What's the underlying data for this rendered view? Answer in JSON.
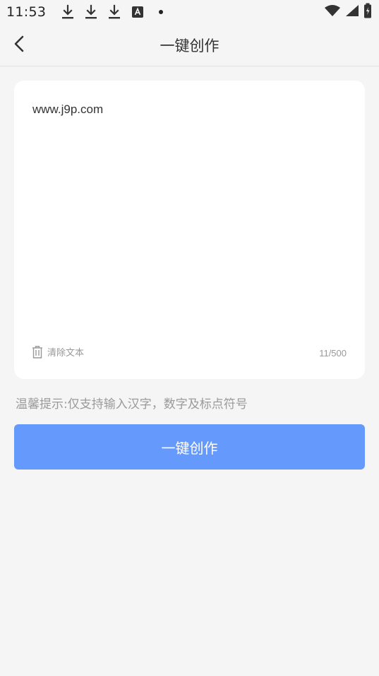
{
  "status_bar": {
    "time": "11:53",
    "icons": [
      "download-icon",
      "download-icon",
      "download-icon",
      "text-a-icon",
      "dot-icon"
    ],
    "right_icons": [
      "wifi-icon",
      "signal-icon",
      "battery-charging-icon"
    ]
  },
  "header": {
    "title": "一键创作",
    "back_icon": "chevron-left-icon"
  },
  "editor": {
    "value": "www.j9p.com",
    "clear_label": "清除文本",
    "clear_icon": "trash-icon",
    "char_count": "11/500"
  },
  "hint": "温馨提示:仅支持输入汉字，数字及标点符号",
  "primary_button": {
    "label": "一键创作",
    "color": "#6699fc"
  }
}
